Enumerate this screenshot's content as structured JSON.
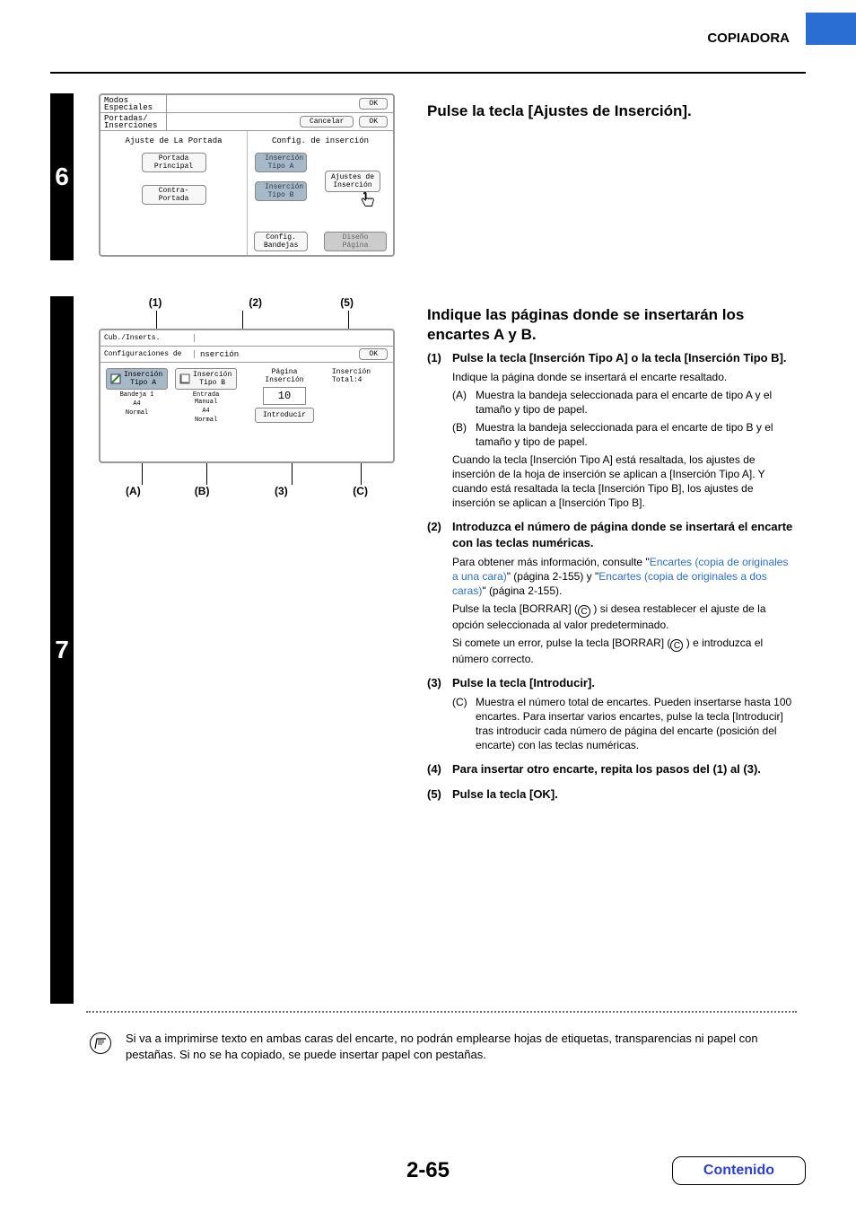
{
  "header": {
    "label": "COPIADORA"
  },
  "step6": {
    "number": "6",
    "title": "Pulse la tecla [Ajustes de Inserción].",
    "panel": {
      "modos_especiales": "Modos\nEspeciales",
      "ok1": "OK",
      "portadas_inserciones": "Portadas/\nInserciones",
      "cancelar": "Cancelar",
      "ok2": "OK",
      "left_header": "Ajuste de La Portada",
      "left_btn1": "Portada\nPrincipal",
      "left_btn2": "Contra-\nPortada",
      "right_header": "Config. de inserción",
      "right_btn1": "Inserción\nTipo A",
      "right_btn2": "Inserción\nTipo B",
      "ajustes_btn": "Ajustes de\nInserción",
      "config_bandejas": "Config.\nBandejas",
      "diseno_pagina": "Diseño Página"
    }
  },
  "step7": {
    "number": "7",
    "title": "Indique las páginas donde se insertarán los encartes A y B.",
    "panel": {
      "row1": "Cub./Inserts.",
      "row2_left": "Configuraciones de",
      "row2_mid": "nserción",
      "row2_ok": "OK",
      "col_a_btn": "Inserción\nTipo A",
      "col_a_l1": "Bandeja 1",
      "col_a_l2": "A4",
      "col_a_l3": "Normal",
      "col_b_btn": "Inserción\nTipo B",
      "col_b_l1": "Entrada\nManual",
      "col_b_l2": "A4",
      "col_b_l3": "Normal",
      "mid_label": "Página\nInserción",
      "mid_num": "10",
      "mid_btn": "Introducir",
      "right_text": "Inserción\nTotal:4"
    },
    "callout_top": {
      "c1": "(1)",
      "c2": "(2)",
      "c5": "(5)"
    },
    "callout_bot": {
      "a": "(A)",
      "b": "(B)",
      "c3": "(3)",
      "c": "(C)"
    },
    "items": {
      "i1": {
        "num": "(1)",
        "title": "Pulse la tecla [Inserción Tipo A] o la tecla [Inserción Tipo B].",
        "p1": "Indique la página donde se insertará el encarte resaltado.",
        "a_label": "(A)",
        "a_text": "Muestra la bandeja seleccionada para el encarte de tipo A y el tamaño y tipo de papel.",
        "b_label": "(B)",
        "b_text": "Muestra la bandeja seleccionada para el encarte de tipo B y el tamaño y tipo de papel.",
        "p2": "Cuando la tecla [Inserción Tipo A] está resaltada, los ajustes de inserción de la hoja de inserción se aplican a [Inserción Tipo A]. Y cuando está resaltada la tecla [Inserción Tipo B], los ajustes de inserción se aplican a [Inserción Tipo B]."
      },
      "i2": {
        "num": "(2)",
        "title": "Introduzca el número de página donde se insertará el encarte con las teclas numéricas.",
        "p1a": "Para obtener más información, consulte \"",
        "link1": "Encartes (copia de originales a una cara)",
        "p1b": "\" (página 2-155) y \"",
        "link2": "Encartes (copia de originales a dos caras)",
        "p1c": "\" (página 2-155).",
        "p2a": "Pulse la tecla [BORRAR] (",
        "p2b": ") si desea restablecer el ajuste de la opción seleccionada al valor predeterminado.",
        "p3a": "Si comete un error, pulse la tecla [BORRAR] (",
        "p3b": ") e introduzca el número correcto."
      },
      "i3": {
        "num": "(3)",
        "title": "Pulse la tecla [Introducir].",
        "c_label": "(C)",
        "c_text": "Muestra el número total de encartes. Pueden insertarse hasta 100 encartes. Para insertar varios encartes, pulse la tecla [Introducir] tras introducir cada número de página del encarte (posición del encarte) con las teclas numéricas."
      },
      "i4": {
        "num": "(4)",
        "title": "Para insertar otro encarte, repita los pasos del (1) al (3)."
      },
      "i5": {
        "num": "(5)",
        "title": "Pulse la tecla [OK]."
      }
    }
  },
  "note": "Si va a imprimirse texto en ambas caras del encarte, no podrán emplearse hojas de etiquetas, transparencias ni papel con pestañas. Si no se ha copiado, se puede insertar papel con pestañas.",
  "page_number": "2-65",
  "contenido": "Contenido",
  "circled_c": "C"
}
